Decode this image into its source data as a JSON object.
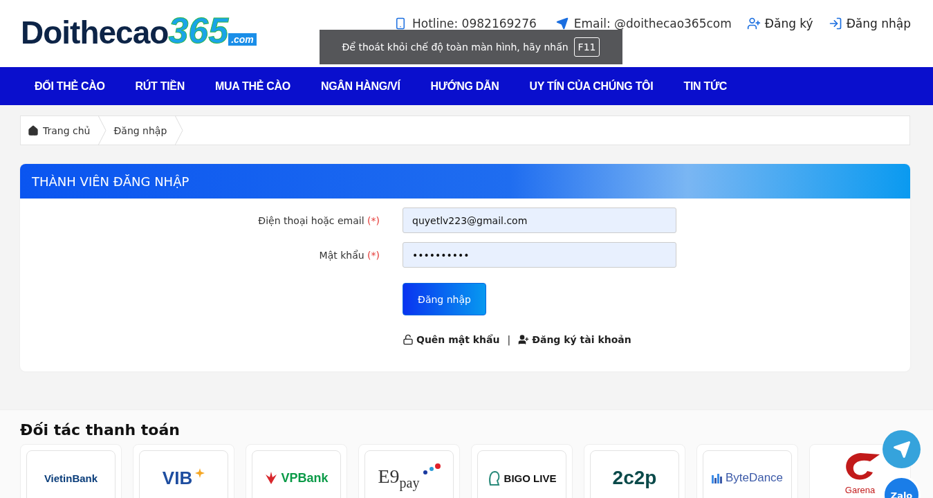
{
  "header": {
    "logo": {
      "main": "Doithecao",
      "number": "365",
      "suffix": ".com"
    },
    "contacts": [
      {
        "kind": "phone",
        "text": "Hotline: 0982169276"
      },
      {
        "kind": "email",
        "text": "Email: @doithecao365com"
      }
    ],
    "account_links": [
      {
        "kind": "register",
        "text": "Đăng ký"
      },
      {
        "kind": "login",
        "text": "Đăng nhập"
      }
    ]
  },
  "nav": [
    "ĐỔI THẺ CÀO",
    "RÚT TIỀN",
    "MUA THẺ CÀO",
    "NGÂN HÀNG/VÍ",
    "HƯỚNG DẪN",
    "UY TÍN CỦA CHÚNG TÔI",
    "TIN TỨC"
  ],
  "breadcrumb": [
    "Trang chủ",
    "Đăng nhập"
  ],
  "login_card": {
    "title": "THÀNH VIÊN ĐĂNG NHẬP",
    "fields": [
      {
        "label": "Điện thoại hoặc email",
        "required": "(*)",
        "value": "quyetlv223@gmail.com"
      },
      {
        "label": "Mật khẩu",
        "required": "(*)",
        "value": "••••••••••"
      }
    ],
    "submit": "Đăng nhập",
    "links": [
      {
        "kind": "forgot",
        "text": "Quên mật khẩu"
      },
      {
        "kind": "register",
        "text": "Đăng ký tài khoản"
      }
    ],
    "separator": "|"
  },
  "partners": {
    "title": "Đối tác thanh toán",
    "items": [
      {
        "kind": "vietinbank",
        "text": "VietinBank"
      },
      {
        "kind": "vib",
        "text": "VIB"
      },
      {
        "kind": "vpbank",
        "text": "VPBank"
      },
      {
        "kind": "e9pay",
        "text": "E9",
        "sub": "pay"
      },
      {
        "kind": "bigo",
        "text": "BIGO LIVE"
      },
      {
        "kind": "c2p",
        "text": "2c2p"
      },
      {
        "kind": "bytedance",
        "text": "ByteDance"
      },
      {
        "kind": "garena",
        "text": "Garena"
      }
    ]
  },
  "floating": {
    "zalo": "Zalo"
  },
  "toast": {
    "message": "Để thoát khỏi chế độ toàn màn hình, hãy nhấn",
    "key": "F11"
  }
}
